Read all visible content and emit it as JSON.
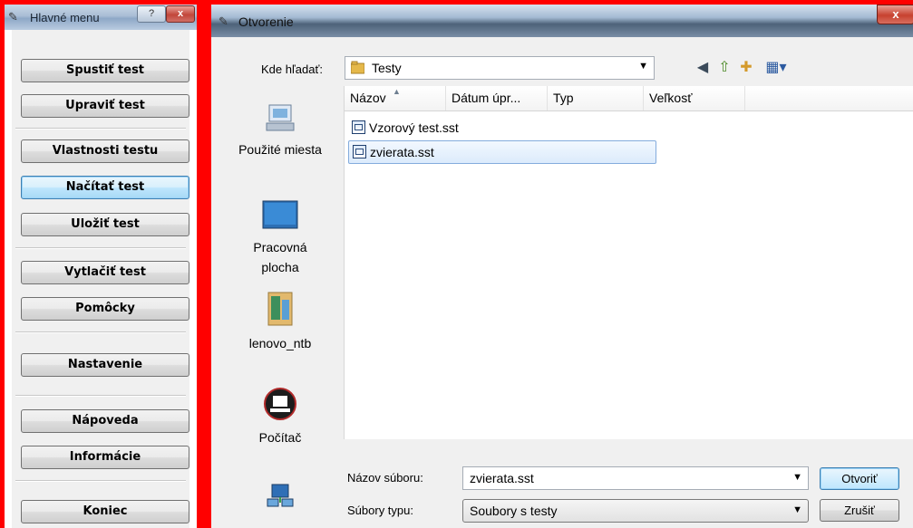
{
  "menu_window": {
    "title": "Hlavné menu",
    "help_label": "?",
    "close_label": "x",
    "buttons": [
      "Spustiť test",
      "Upraviť test",
      "Vlastnosti testu",
      "Načítať test",
      "Uložiť test",
      "Vytlačiť test",
      "Pomôcky",
      "Nastavenie",
      "Nápoveda",
      "Informácie",
      "Koniec"
    ]
  },
  "open_dialog": {
    "title": "Otvorenie",
    "close_label": "x",
    "look_in_label": "Kde hľadať:",
    "look_in_value": "Testy",
    "places": [
      {
        "label": "Použité miesta",
        "icon": "recent-places-icon"
      },
      {
        "label": "Pracovná plocha",
        "icon": "desktop-icon"
      },
      {
        "label": "lenovo_ntb",
        "icon": "user-folder-icon"
      },
      {
        "label": "Počítač",
        "icon": "computer-icon"
      },
      {
        "label": "",
        "icon": "network-icon"
      }
    ],
    "columns": [
      "Názov",
      "Dátum úpr...",
      "Typ",
      "Veľkosť"
    ],
    "files": [
      {
        "name": "Vzorový test.sst",
        "selected": false
      },
      {
        "name": "zvierata.sst",
        "selected": true
      }
    ],
    "file_name_label": "Názov súboru:",
    "file_name_value": "zvierata.sst",
    "file_type_label": "Súbory typu:",
    "file_type_value": "Soubory s testy",
    "open_button": "Otvoriť",
    "cancel_button": "Zrušiť"
  }
}
